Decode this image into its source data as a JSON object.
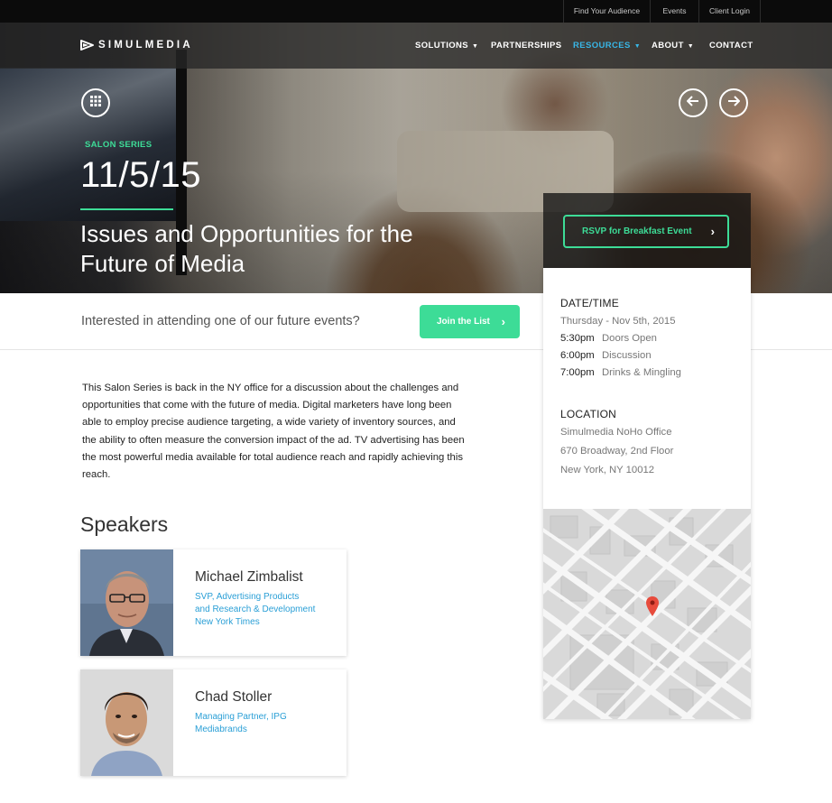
{
  "utility_nav": [
    "Find Your Audience",
    "Events",
    "Client Login"
  ],
  "brand": "SIMULMEDIA",
  "main_nav": [
    {
      "label": "SOLUTIONS",
      "has_caret": true,
      "active": false
    },
    {
      "label": "PARTNERSHIPS",
      "has_caret": false,
      "active": false
    },
    {
      "label": "RESOURCES",
      "has_caret": true,
      "active": true
    },
    {
      "label": "ABOUT",
      "has_caret": true,
      "active": false
    },
    {
      "label": "CONTACT",
      "has_caret": false,
      "active": false
    }
  ],
  "hero": {
    "eyebrow": "SALON SERIES",
    "date": "11/5/15",
    "title": "Issues and Opportunities for the Future of Media",
    "rsvp_label": "RSVP for Breakfast Event",
    "grid_icon": "grid-icon",
    "prev_icon": "arrow-left-icon",
    "next_icon": "arrow-right-icon"
  },
  "join": {
    "question": "Interested in attending one of our future events?",
    "button_label": "Join the List"
  },
  "description": "This Salon Series is back in the NY office for a discussion about the challenges and opportunities that come with the future of media.  Digital marketers have long been able to employ precise audience targeting, a wide variety of inventory sources, and the ability to often measure the conversion impact of the ad.  TV advertising has been the most powerful media available for total audience reach and rapidly achieving this reach.",
  "speakers": {
    "heading": "Speakers",
    "items": [
      {
        "name": "Michael Zimbalist",
        "role_lines": [
          "SVP, Advertising Products",
          "and Research & Development",
          "New York Times"
        ]
      },
      {
        "name": "Chad Stoller",
        "role_lines": [
          "Managing Partner, IPG",
          "Mediabrands"
        ]
      }
    ]
  },
  "event": {
    "datetime_heading": "DATE/TIME",
    "date": "Thursday - Nov 5th, 2015",
    "schedule": [
      {
        "time": "5:30pm",
        "label": "Doors Open"
      },
      {
        "time": "6:00pm",
        "label": "Discussion"
      },
      {
        "time": "7:00pm",
        "label": "Drinks & Mingling"
      }
    ],
    "location_heading": "LOCATION",
    "location_lines": [
      "Simulmedia NoHo Office",
      "670 Broadway, 2nd Floor",
      "New York, NY  10012"
    ],
    "map_pin_icon": "map-pin-icon"
  },
  "colors": {
    "accent_green": "#3ddc97",
    "link_blue": "#2a9fd6",
    "nav_active": "#38b6e6"
  }
}
